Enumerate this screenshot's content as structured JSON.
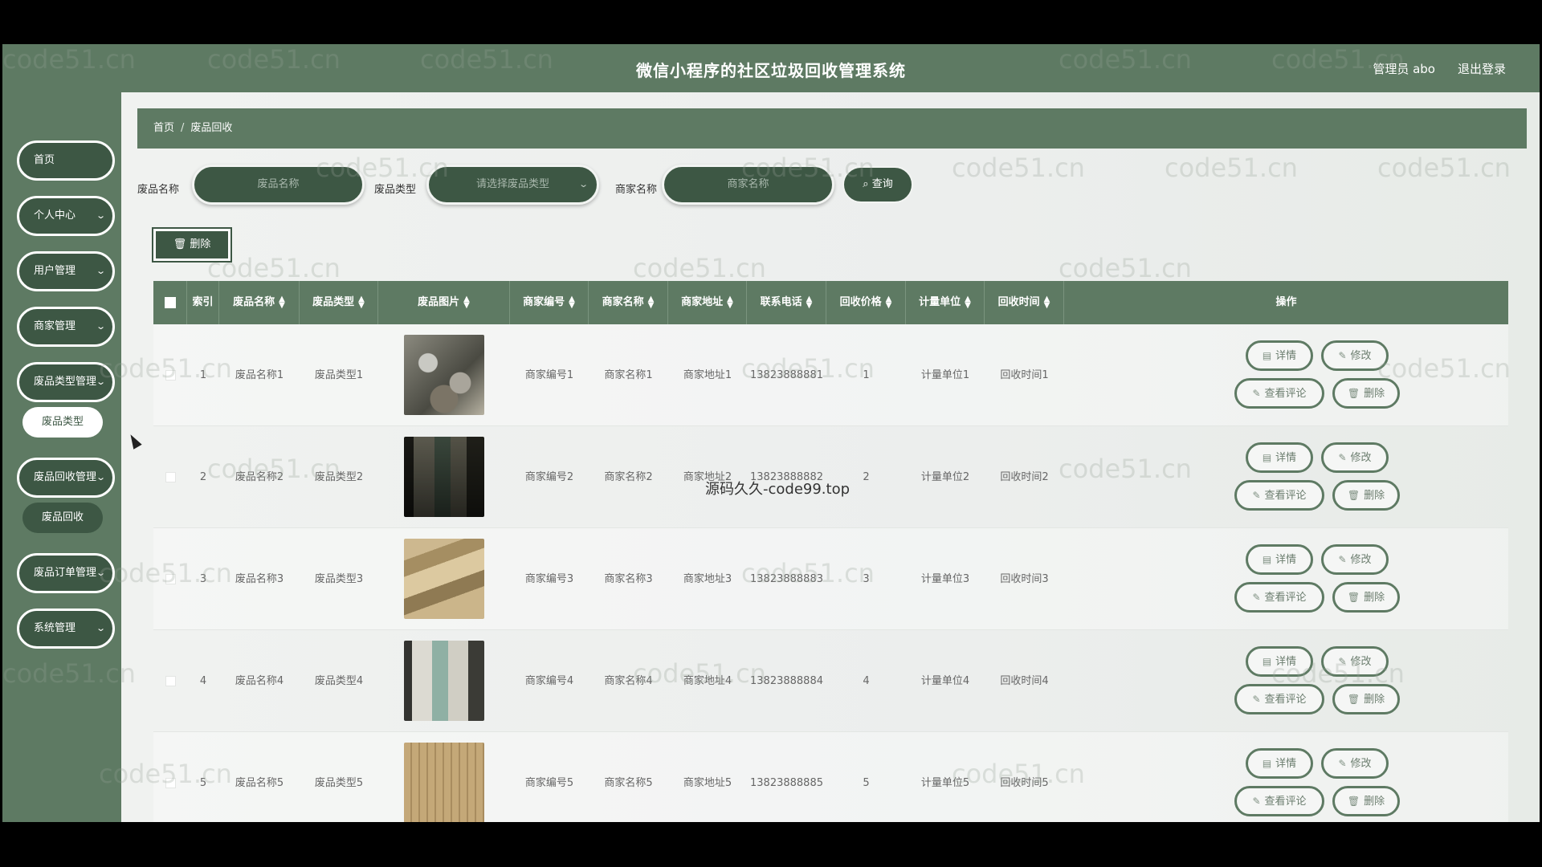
{
  "header": {
    "title": "微信小程序的社区垃圾回收管理系统",
    "user": "管理员 abo",
    "logout": "退出登录"
  },
  "sidebar": {
    "items": [
      {
        "label": "首页",
        "has_chevron": false
      },
      {
        "label": "个人中心",
        "has_chevron": true
      },
      {
        "label": "用户管理",
        "has_chevron": true
      },
      {
        "label": "商家管理",
        "has_chevron": true
      },
      {
        "label": "废品类型管理",
        "has_chevron": true
      },
      {
        "label": "废品类型",
        "sub": true,
        "active": true
      },
      {
        "label": "废品回收管理",
        "has_chevron": true
      },
      {
        "label": "废品回收",
        "sub": true,
        "active": false
      },
      {
        "label": "废品订单管理",
        "has_chevron": true
      },
      {
        "label": "系统管理",
        "has_chevron": true
      }
    ]
  },
  "breadcrumb": {
    "home": "首页",
    "sep": "/",
    "current": "废品回收"
  },
  "search": {
    "name_label": "废品名称",
    "name_placeholder": "废品名称",
    "type_label": "废品类型",
    "type_placeholder": "请选择废品类型",
    "merchant_label": "商家名称",
    "merchant_placeholder": "商家名称",
    "button": "查询"
  },
  "toolbar": {
    "delete_label": "删除"
  },
  "table": {
    "columns": [
      "索引",
      "废品名称",
      "废品类型",
      "废品图片",
      "商家编号",
      "商家名称",
      "商家地址",
      "联系电话",
      "回收价格",
      "计量单位",
      "回收时间",
      "操作"
    ],
    "rows": [
      {
        "index": "1",
        "name": "废品名称1",
        "type": "废品类型1",
        "merchant_no": "商家编号1",
        "merchant": "商家名称1",
        "address": "商家地址1",
        "phone": "13823888881",
        "price": "1",
        "unit": "计量单位1",
        "time": "回收时间1"
      },
      {
        "index": "2",
        "name": "废品名称2",
        "type": "废品类型2",
        "merchant_no": "商家编号2",
        "merchant": "商家名称2",
        "address": "商家地址2",
        "phone": "13823888882",
        "price": "2",
        "unit": "计量单位2",
        "time": "回收时间2"
      },
      {
        "index": "3",
        "name": "废品名称3",
        "type": "废品类型3",
        "merchant_no": "商家编号3",
        "merchant": "商家名称3",
        "address": "商家地址3",
        "phone": "13823888883",
        "price": "3",
        "unit": "计量单位3",
        "time": "回收时间3"
      },
      {
        "index": "4",
        "name": "废品名称4",
        "type": "废品类型4",
        "merchant_no": "商家编号4",
        "merchant": "商家名称4",
        "address": "商家地址4",
        "phone": "13823888884",
        "price": "4",
        "unit": "计量单位4",
        "time": "回收时间4"
      },
      {
        "index": "5",
        "name": "废品名称5",
        "type": "废品类型5",
        "merchant_no": "商家编号5",
        "merchant": "商家名称5",
        "address": "商家地址5",
        "phone": "13823888885",
        "price": "5",
        "unit": "计量单位5",
        "time": "回收时间5"
      }
    ],
    "actions": {
      "detail": "详情",
      "edit": "修改",
      "comments": "查看评论",
      "delete": "删除"
    }
  },
  "overlay": {
    "watermark": "code51.cn",
    "source_mark": "源码久久-code99.top"
  },
  "colors": {
    "primary": "#5e7a63",
    "dark": "#3d5744",
    "background": "#ecefec"
  }
}
